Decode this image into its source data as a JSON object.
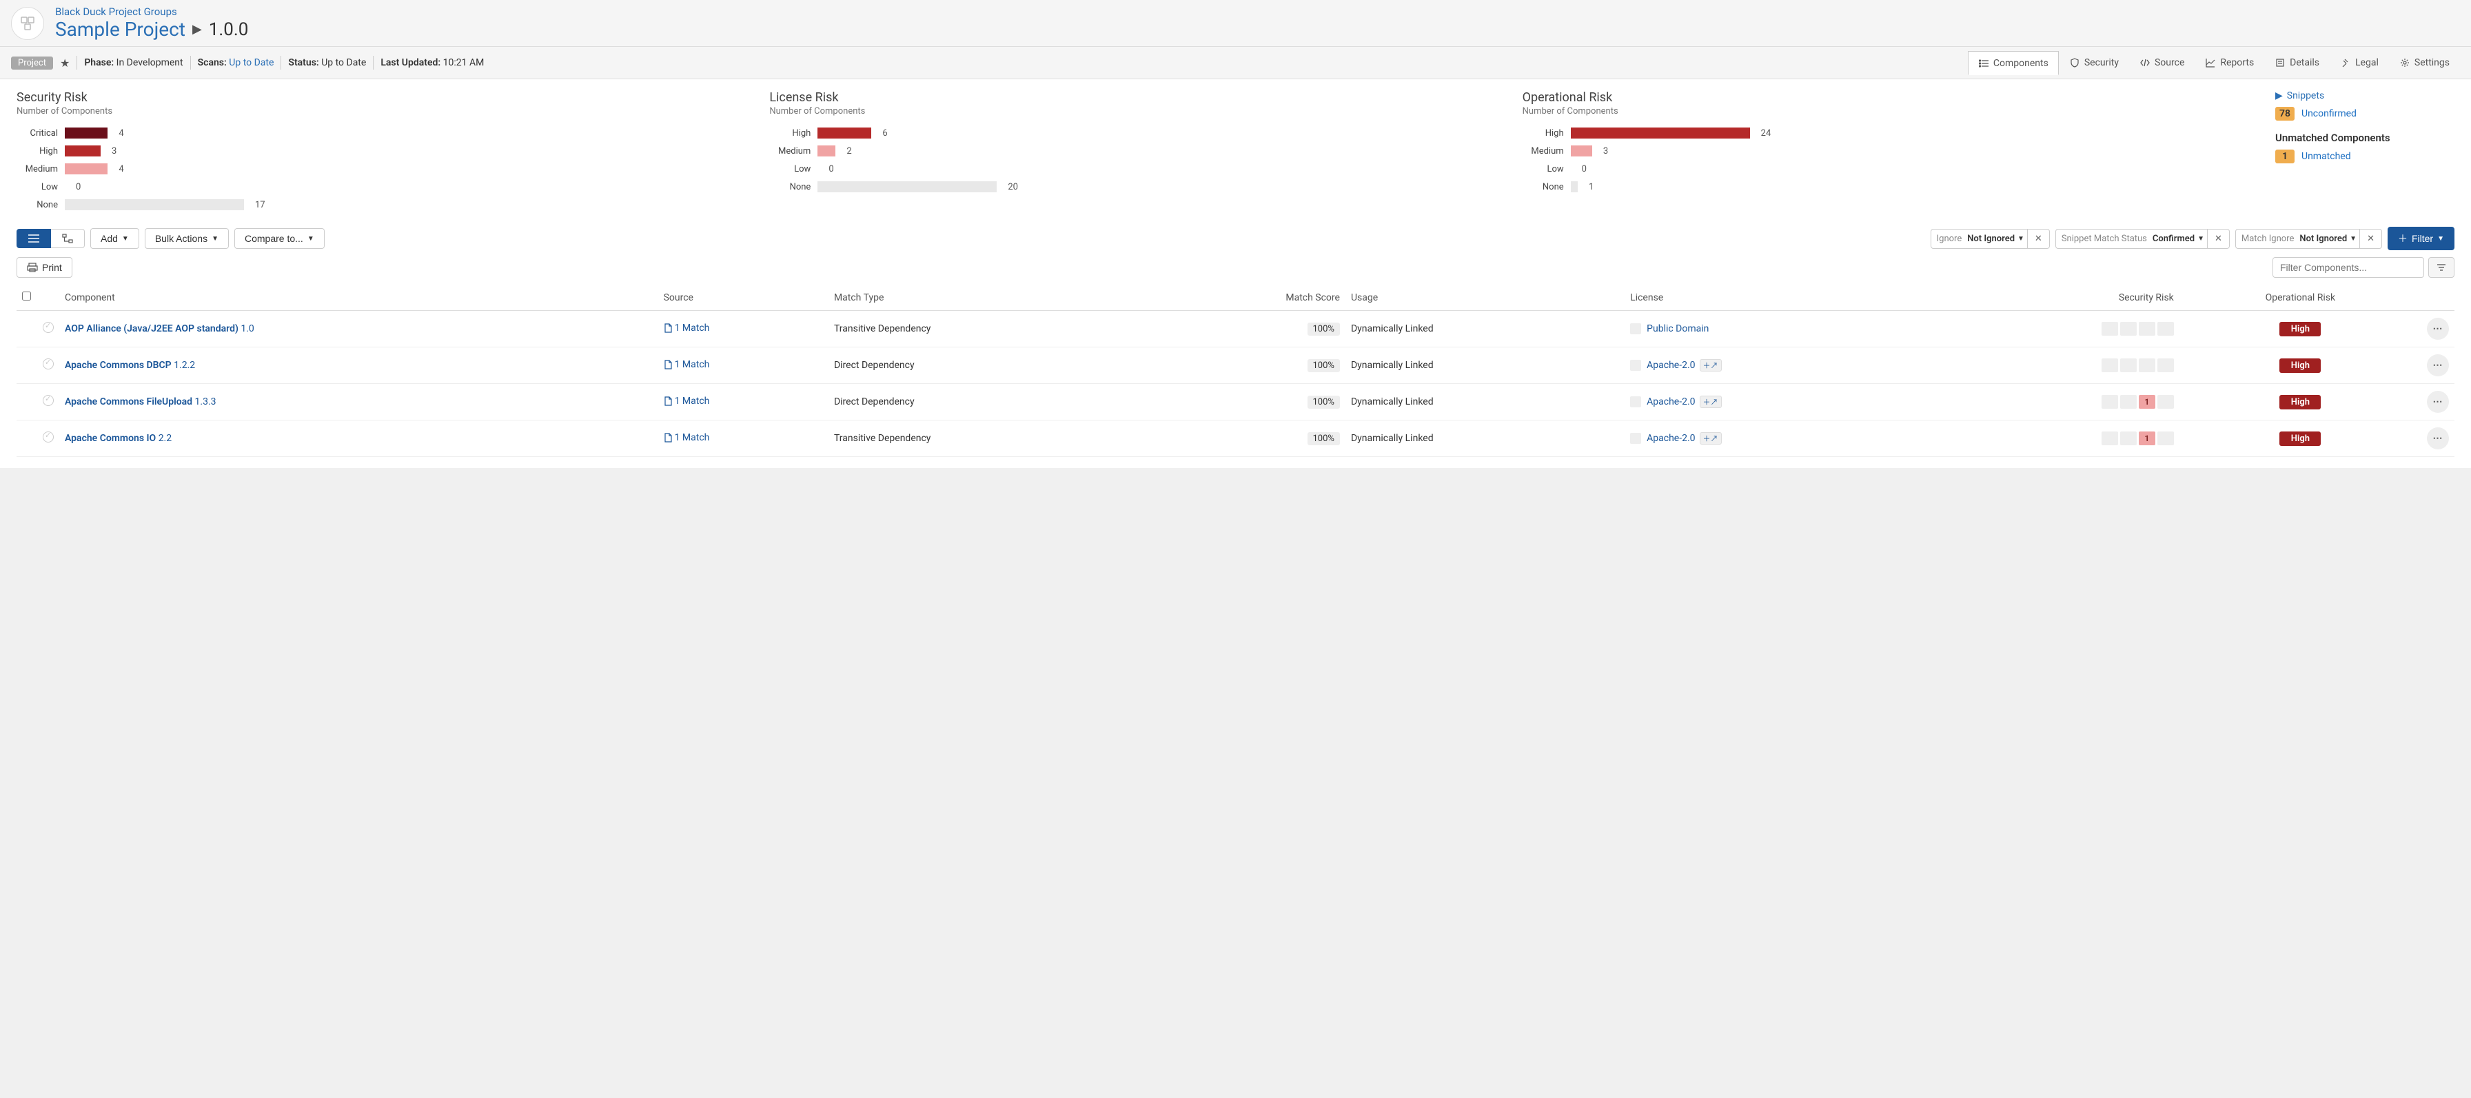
{
  "header": {
    "breadcrumb": "Black Duck Project Groups",
    "project": "Sample Project",
    "version": "1.0.0"
  },
  "statusbar": {
    "badge": "Project",
    "phase_label": "Phase:",
    "phase_value": "In Development",
    "scans_label": "Scans:",
    "scans_value": "Up to Date",
    "status_label": "Status:",
    "status_value": "Up to Date",
    "updated_label": "Last Updated:",
    "updated_value": "10:21 AM"
  },
  "tabs": [
    {
      "label": "Components",
      "icon": "list-icon",
      "active": true
    },
    {
      "label": "Security",
      "icon": "shield-icon",
      "active": false
    },
    {
      "label": "Source",
      "icon": "code-icon",
      "active": false
    },
    {
      "label": "Reports",
      "icon": "chart-icon",
      "active": false
    },
    {
      "label": "Details",
      "icon": "details-icon",
      "active": false
    },
    {
      "label": "Legal",
      "icon": "gavel-icon",
      "active": false
    },
    {
      "label": "Settings",
      "icon": "gear-icon",
      "active": false
    }
  ],
  "risk_panels": {
    "security": {
      "title": "Security Risk",
      "subtitle": "Number of Components",
      "max_width": 260,
      "bars": [
        {
          "label": "Critical",
          "value": 4,
          "width_pct": 24,
          "cls": "c-critical"
        },
        {
          "label": "High",
          "value": 3,
          "width_pct": 20,
          "cls": "c-high"
        },
        {
          "label": "Medium",
          "value": 4,
          "width_pct": 24,
          "cls": "c-medium"
        },
        {
          "label": "Low",
          "value": 0,
          "width_pct": 0,
          "cls": "c-low"
        },
        {
          "label": "None",
          "value": 17,
          "width_pct": 100,
          "cls": "c-none"
        }
      ]
    },
    "license": {
      "title": "License Risk",
      "subtitle": "Number of Components",
      "max_width": 260,
      "bars": [
        {
          "label": "High",
          "value": 6,
          "width_pct": 30,
          "cls": "c-high"
        },
        {
          "label": "Medium",
          "value": 2,
          "width_pct": 10,
          "cls": "c-medium"
        },
        {
          "label": "Low",
          "value": 0,
          "width_pct": 0,
          "cls": "c-low"
        },
        {
          "label": "None",
          "value": 20,
          "width_pct": 100,
          "cls": "c-none"
        }
      ]
    },
    "operational": {
      "title": "Operational Risk",
      "subtitle": "Number of Components",
      "max_width": 260,
      "bars": [
        {
          "label": "High",
          "value": 24,
          "width_pct": 100,
          "cls": "c-high"
        },
        {
          "label": "Medium",
          "value": 3,
          "width_pct": 12,
          "cls": "c-medium"
        },
        {
          "label": "Low",
          "value": 0,
          "width_pct": 0,
          "cls": "c-low"
        },
        {
          "label": "None",
          "value": 1,
          "width_pct": 4,
          "cls": "c-none"
        }
      ]
    }
  },
  "side": {
    "snippets_label": "Snippets",
    "unconfirmed_count": "78",
    "unconfirmed_label": "Unconfirmed",
    "unmatched_heading": "Unmatched Components",
    "unmatched_count": "1",
    "unmatched_label": "Unmatched"
  },
  "toolbar": {
    "add": "Add",
    "bulk": "Bulk Actions",
    "compare": "Compare to...",
    "print": "Print",
    "filter": "Filter",
    "filter_placeholder": "Filter Components..."
  },
  "filter_chips": [
    {
      "label": "Ignore",
      "value": "Not Ignored"
    },
    {
      "label": "Snippet Match Status",
      "value": "Confirmed"
    },
    {
      "label": "Match Ignore",
      "value": "Not Ignored"
    }
  ],
  "table": {
    "headers": {
      "component": "Component",
      "source": "Source",
      "match_type": "Match Type",
      "match_score": "Match Score",
      "usage": "Usage",
      "license": "License",
      "security": "Security Risk",
      "operational": "Operational Risk"
    },
    "rows": [
      {
        "name": "AOP Alliance (Java/J2EE AOP standard)",
        "version": "1.0",
        "source": "1 Match",
        "match_type": "Transitive Dependency",
        "score": "100%",
        "usage": "Dynamically Linked",
        "license": "Public Domain",
        "license_extra": false,
        "sec_cells": [
          null,
          null,
          null,
          null
        ],
        "op": "High"
      },
      {
        "name": "Apache Commons DBCP",
        "version": "1.2.2",
        "source": "1 Match",
        "match_type": "Direct Dependency",
        "score": "100%",
        "usage": "Dynamically Linked",
        "license": "Apache-2.0",
        "license_extra": true,
        "sec_cells": [
          null,
          null,
          null,
          null
        ],
        "op": "High"
      },
      {
        "name": "Apache Commons FileUpload",
        "version": "1.3.3",
        "source": "1 Match",
        "match_type": "Direct Dependency",
        "score": "100%",
        "usage": "Dynamically Linked",
        "license": "Apache-2.0",
        "license_extra": true,
        "sec_cells": [
          null,
          null,
          "1",
          null
        ],
        "op": "High"
      },
      {
        "name": "Apache Commons IO",
        "version": "2.2",
        "source": "1 Match",
        "match_type": "Transitive Dependency",
        "score": "100%",
        "usage": "Dynamically Linked",
        "license": "Apache-2.0",
        "license_extra": true,
        "sec_cells": [
          null,
          null,
          "1",
          null
        ],
        "op": "High"
      }
    ]
  },
  "chart_data": [
    {
      "type": "bar",
      "title": "Security Risk",
      "ylabel": "Number of Components",
      "categories": [
        "Critical",
        "High",
        "Medium",
        "Low",
        "None"
      ],
      "values": [
        4,
        3,
        4,
        0,
        17
      ]
    },
    {
      "type": "bar",
      "title": "License Risk",
      "ylabel": "Number of Components",
      "categories": [
        "High",
        "Medium",
        "Low",
        "None"
      ],
      "values": [
        6,
        2,
        0,
        20
      ]
    },
    {
      "type": "bar",
      "title": "Operational Risk",
      "ylabel": "Number of Components",
      "categories": [
        "High",
        "Medium",
        "Low",
        "None"
      ],
      "values": [
        24,
        3,
        0,
        1
      ]
    }
  ]
}
